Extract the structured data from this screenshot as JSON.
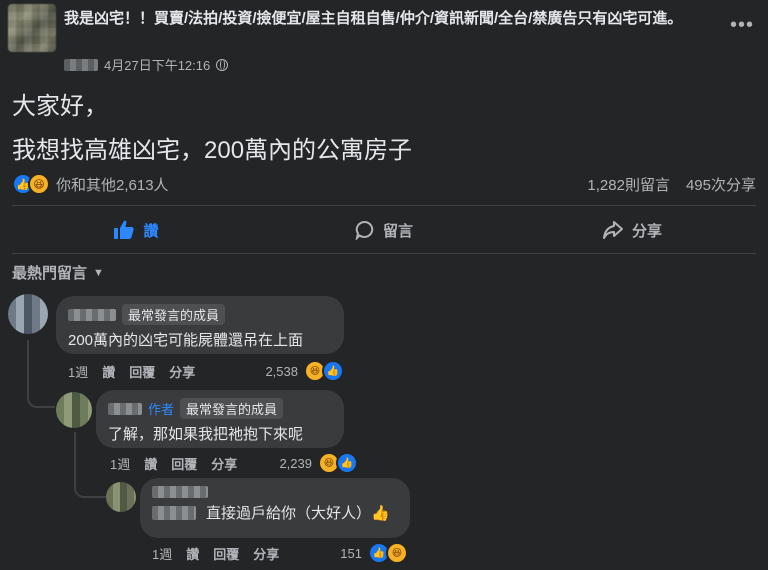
{
  "post": {
    "group_name": "我是凶宅！！買賣/法拍/投資/撿便宜/屋主自租自售/仲介/資訊新聞/全台/禁廣告只有凶宅可進。",
    "timestamp": "4月27日下午12:16",
    "more_icon": "more-horizontal-icon",
    "privacy_icon": "globe-icon",
    "text_line1": "大家好，",
    "text_line2": "我想找高雄凶宅，200萬內的公寓房子"
  },
  "stats": {
    "reactions_label": "你和其他2,613人",
    "comments": "1,282則留言",
    "shares": "495次分享"
  },
  "actions": {
    "like": "讚",
    "comment": "留言",
    "share": "分享"
  },
  "sort": {
    "label": "最熱門留言"
  },
  "comments": [
    {
      "badge": "最常發言的成員",
      "author_tag": "",
      "text": "200萬內的凶宅可能屍體還吊在上面",
      "time": "1週",
      "like": "讚",
      "reply": "回覆",
      "share": "分享",
      "reaction_count": "2,538"
    },
    {
      "badge": "最常發言的成員",
      "author_tag": "作者",
      "text": "了解，那如果我把祂抱下來呢",
      "time": "1週",
      "like": "讚",
      "reply": "回覆",
      "share": "分享",
      "reaction_count": "2,239"
    },
    {
      "badge": "",
      "author_tag": "",
      "text": "直接過戶給你（大好人）👍",
      "time": "1週",
      "like": "讚",
      "reply": "回覆",
      "share": "分享",
      "reaction_count": "151"
    }
  ],
  "colors": {
    "background": "#242526",
    "accent": "#2d88ff",
    "bubble": "#3a3b3c",
    "text": "#e4e6eb",
    "muted": "#b0b3b8"
  }
}
